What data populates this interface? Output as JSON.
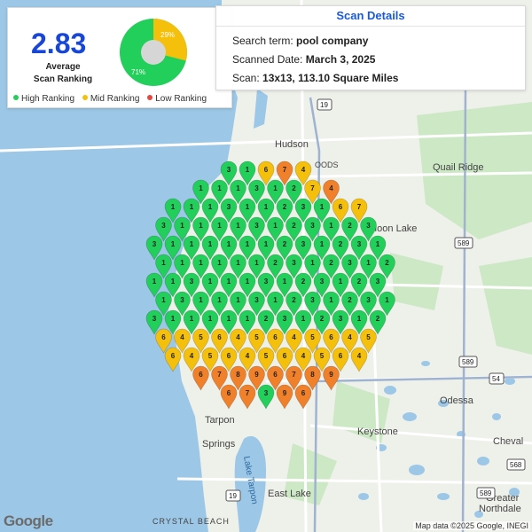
{
  "summary": {
    "average_value": "2.83",
    "average_label_line1": "Average",
    "average_label_line2": "Scan Ranking",
    "pie": {
      "high_percent": 71,
      "mid_percent": 29,
      "high_label": "71%",
      "mid_label": "29%"
    },
    "legend": [
      {
        "label": "High Ranking",
        "color": "#22cf5a"
      },
      {
        "label": "Mid Ranking",
        "color": "#f5c00c"
      },
      {
        "label": "Low Ranking",
        "color": "#e5483f"
      }
    ]
  },
  "scan_details": {
    "title": "Scan Details",
    "search_label": "Search term: ",
    "search_value": "pool company",
    "date_label": "Scanned Date: ",
    "date_value": "March 3, 2025",
    "scan_label": "Scan: ",
    "scan_value": "13x13, 113.10 Square Miles"
  },
  "map_labels": {
    "places": [
      "Hudson",
      "Quail Ridge",
      "Moon Lake",
      "Odessa",
      "Keystone",
      "Cheval",
      "Tarpon Springs",
      "East Lake",
      "Greater Northdale",
      "CRYSTAL BEACH",
      "Lake Tarpon",
      "OODS"
    ],
    "route_shields": [
      "19",
      "589",
      "589",
      "54",
      "568",
      "19",
      "589",
      "589"
    ]
  },
  "attribution": "Map data ©2025 Google, INEGI",
  "logo": "Google",
  "colors": {
    "water": "#9cc7e6",
    "land": "#eef0ea",
    "high": "#22cf5a",
    "mid": "#f5c00c",
    "low_orange": "#f0802a",
    "title_blue": "#1a5ad8",
    "avg_blue": "#1746d8"
  }
}
